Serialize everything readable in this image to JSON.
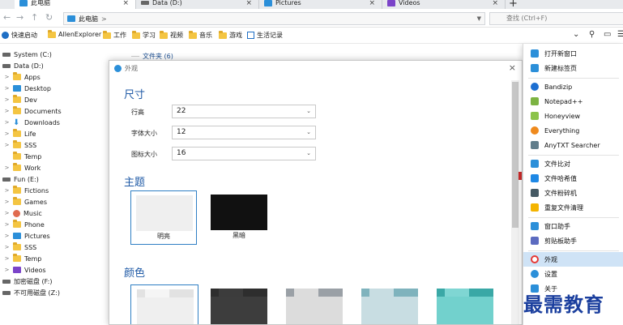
{
  "tabs": [
    {
      "label": "此电脑",
      "color": "#2b8fd9"
    },
    {
      "label": "Data (D:)",
      "color": "#666666"
    },
    {
      "label": "Pictures",
      "color": "#2b8fd9"
    },
    {
      "label": "Videos",
      "color": "#7b43c9"
    }
  ],
  "tab_close": "×",
  "tab_add": "+",
  "nav": {
    "back": "←",
    "forward": "→",
    "up": "↑",
    "refresh": "↻"
  },
  "address": {
    "crumb": "此电脑",
    "sep": ">"
  },
  "search": {
    "placeholder": "查找 (Ctrl+F)"
  },
  "bookmarks": [
    {
      "label": "快速启动",
      "icon": "lightning-icon"
    },
    {
      "label": "AllenExplorer",
      "icon": "folder-icon"
    },
    {
      "label": "工作",
      "icon": "folder-icon"
    },
    {
      "label": "学习",
      "icon": "folder-icon"
    },
    {
      "label": "视频",
      "icon": "folder-icon"
    },
    {
      "label": "音乐",
      "icon": "folder-icon"
    },
    {
      "label": "游戏",
      "icon": "folder-icon"
    },
    {
      "label": "生活记录",
      "icon": "grid-icon"
    }
  ],
  "toolbar_right": {
    "chevron": "⌄",
    "search": "⚲",
    "window": "▭",
    "menu": "☰"
  },
  "sidebar": [
    {
      "label": "System (C:)",
      "level": 0,
      "icon": "drive"
    },
    {
      "label": "Data (D:)",
      "level": 0,
      "icon": "drive"
    },
    {
      "label": "Apps",
      "level": 1,
      "icon": "folder"
    },
    {
      "label": "Desktop",
      "level": 1,
      "icon": "desktop"
    },
    {
      "label": "Dev",
      "level": 1,
      "icon": "folder"
    },
    {
      "label": "Documents",
      "level": 1,
      "icon": "folder"
    },
    {
      "label": "Downloads",
      "level": 1,
      "icon": "download"
    },
    {
      "label": "Life",
      "level": 1,
      "icon": "folder"
    },
    {
      "label": "SSS",
      "level": 1,
      "icon": "folder"
    },
    {
      "label": "Temp",
      "level": 1,
      "icon": "folder"
    },
    {
      "label": "Work",
      "level": 1,
      "icon": "folder"
    },
    {
      "label": "Fun (E:)",
      "level": 0,
      "icon": "drive"
    },
    {
      "label": "Fictions",
      "level": 1,
      "icon": "folder"
    },
    {
      "label": "Games",
      "level": 1,
      "icon": "folder"
    },
    {
      "label": "Music",
      "level": 1,
      "icon": "music"
    },
    {
      "label": "Phone",
      "level": 1,
      "icon": "folder"
    },
    {
      "label": "Pictures",
      "level": 1,
      "icon": "pictures"
    },
    {
      "label": "SSS",
      "level": 1,
      "icon": "folder"
    },
    {
      "label": "Temp",
      "level": 1,
      "icon": "folder"
    },
    {
      "label": "Videos",
      "level": 1,
      "icon": "videos"
    },
    {
      "label": "加密磁盘 (F:)",
      "level": 0,
      "icon": "drive"
    },
    {
      "label": "不可用磁盘 (Z:)",
      "level": 0,
      "icon": "drive"
    }
  ],
  "content": {
    "group": "文件夹 (6)"
  },
  "dialog": {
    "title": "外观",
    "close": "×",
    "size_section": "尺寸",
    "fields": [
      {
        "label": "行高",
        "value": "22"
      },
      {
        "label": "字体大小",
        "value": "12"
      },
      {
        "label": "图标大小",
        "value": "16"
      }
    ],
    "theme_section": "主题",
    "themes": [
      {
        "label": "明亮",
        "color": "#efefef"
      },
      {
        "label": "黑暗",
        "color": "#111111"
      }
    ],
    "color_section": "颜色",
    "colors": [
      {
        "bar": "#e2e2e2",
        "tab": "#f5f5f5",
        "body": "#efefef"
      },
      {
        "bar": "#2e2e2e",
        "tab": "#3c3c3c",
        "body": "#3d3d3d"
      },
      {
        "bar": "#9aa0a6",
        "tab": "#dcdcdc",
        "body": "#dcdcdc"
      },
      {
        "bar": "#7fb3bd",
        "tab": "#c8dde2",
        "body": "#c8dde2"
      },
      {
        "bar": "#3aa8a6",
        "tab": "#7fd6d3",
        "body": "#72d1cd"
      }
    ]
  },
  "menu": [
    {
      "label": "打开新窗口",
      "color": "#2b8fd9"
    },
    {
      "label": "新建标签页",
      "color": "#2b8fd9"
    },
    {
      "label": "Bandizip",
      "color": "#1d6fd1"
    },
    {
      "label": "Notepad++",
      "color": "#7cb342"
    },
    {
      "label": "Honeyview",
      "color": "#8bc34a"
    },
    {
      "label": "Everything",
      "color": "#ef8a1d"
    },
    {
      "label": "AnyTXT Searcher",
      "color": "#607d8b"
    },
    {
      "label": "文件比对",
      "color": "#2b8fd9"
    },
    {
      "label": "文件哈希值",
      "color": "#1e88e5"
    },
    {
      "label": "文件粉碎机",
      "color": "#455a64"
    },
    {
      "label": "重复文件清理",
      "color": "#f4b400"
    },
    {
      "label": "窗口助手",
      "color": "#2b8fd9"
    },
    {
      "label": "剪贴板助手",
      "color": "#5c6bc0"
    },
    {
      "label": "外观",
      "color": "#e53935"
    },
    {
      "label": "设置",
      "color": "#2b8fd9"
    },
    {
      "label": "关于",
      "color": "#2b8fd9"
    }
  ],
  "watermark": "最需教育"
}
